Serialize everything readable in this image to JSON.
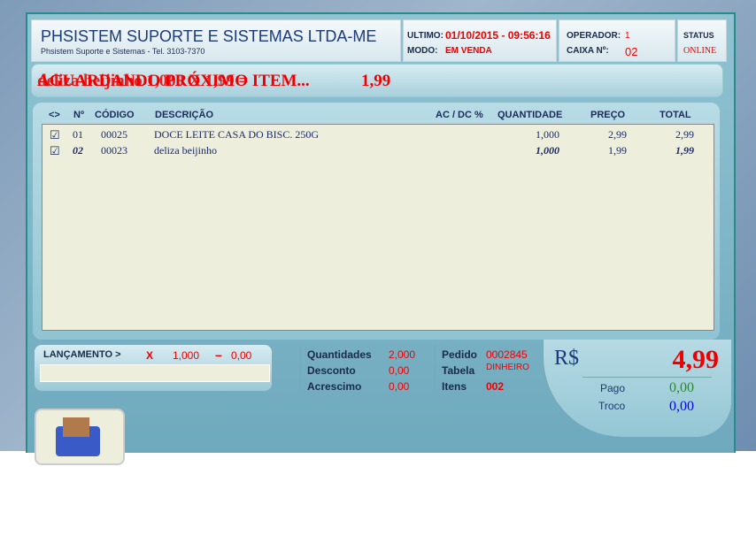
{
  "header": {
    "company": "PHSISTEM SUPORTE E SISTEMAS LTDA-ME",
    "subtitle": "Phsistem Suporte e Sistemas - Tel. 3103-7370",
    "ultimo_label": "ULTIMO:",
    "ultimo_value": "01/10/2015 - 09:56:16",
    "modo_label": "MODO:",
    "modo_value": "EM VENDA",
    "operador_label": "OPERADOR:",
    "operador_value": "1",
    "caixa_label": "CAIXA Nº:",
    "caixa_value": "02",
    "status_label": "STATUS",
    "status_value": "ONLINE"
  },
  "banner": {
    "message": "AGUARDANDO PRÓXIMO ITEM...",
    "overlay": "deliza beijinho  1,000 X 1,99 =",
    "price": "1,99"
  },
  "table": {
    "headers": [
      "<>",
      "Nº",
      "CÓDIGO",
      "DESCRIÇÃO",
      "AC / DC %",
      "QUANTIDADE",
      "PREÇO",
      "TOTAL"
    ],
    "rows": [
      {
        "n": "01",
        "codigo": "00025",
        "descricao": "DOCE LEITE CASA DO BISC. 250G",
        "qtd": "1,000",
        "preco": "2,99",
        "total": "2,99"
      },
      {
        "n": "02",
        "codigo": "00023",
        "descricao": "deliza beijinho",
        "qtd": "1,000",
        "preco": "1,99",
        "total": "1,99"
      }
    ]
  },
  "lancamento": {
    "label": "LANÇAMENTO >",
    "x": "X",
    "qtd": "1,000",
    "minus": "–",
    "desconto": "0,00",
    "input": ""
  },
  "summary": {
    "quantidades_label": "Quantidades",
    "quantidades": "2,000",
    "desconto_label": "Desconto",
    "desconto": "0,00",
    "acrescimo_label": "Acrescimo",
    "acrescimo": "0,00",
    "pedido_label": "Pedido",
    "pedido": "0002845",
    "tabela_label": "Tabela",
    "tabela": "DINHEIRO",
    "itens_label": "Itens",
    "itens": "002"
  },
  "totals": {
    "currency": "R$",
    "total": "4,99",
    "pago_label": "Pago",
    "pago": "0,00",
    "troco_label": "Troco",
    "troco": "0,00"
  }
}
